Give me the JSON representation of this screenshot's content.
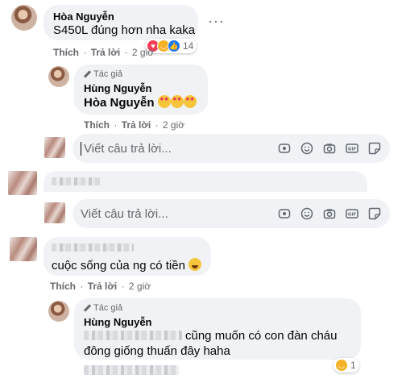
{
  "comments": [
    {
      "author": "Hòa Nguyễn",
      "text": "S450L đúng hơn nha kaka",
      "reaction_count": "14",
      "reaction_icons": [
        "love-icon",
        "haha-icon",
        "like-icon"
      ],
      "like_label": "Thích",
      "reply_label": "Trả lời",
      "time": "2 giờ",
      "more_icon": "···"
    }
  ],
  "replies": [
    {
      "badge": "Tác giả",
      "author": "Hùng Nguyễn",
      "text": "Hòa Nguyễn",
      "like_label": "Thích",
      "reply_label": "Trả lời",
      "time": "2 giờ"
    },
    {
      "badge": "Tác giả",
      "author": "Hùng Nguyễn",
      "line1": "cũng muốn có con đàn cháu",
      "line2": "đông giống thuấn đây haha",
      "reaction_count": "1"
    }
  ],
  "third_comment": {
    "text": "cuộc sống của ng có tiền",
    "like_label": "Thích",
    "reply_label": "Trả lời",
    "time": "2 giờ"
  },
  "reply_inputs": [
    {
      "placeholder": "Viết câu trả lời..."
    },
    {
      "placeholder": "Viết câu trả lời..."
    }
  ],
  "separator": "·",
  "colors": {
    "bubble": "#f0f2f5",
    "secondary_text": "#65676b",
    "text": "#050505",
    "love": "#f33e58",
    "haha": "#f7b125",
    "like": "#1877f2"
  }
}
